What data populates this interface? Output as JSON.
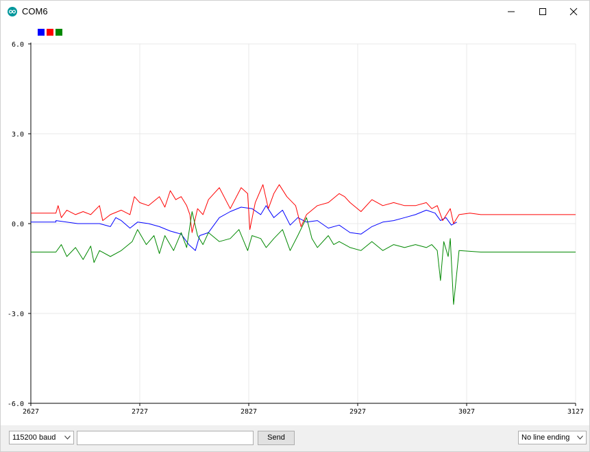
{
  "window": {
    "title": "COM6"
  },
  "legend": {
    "colors": [
      "#0000ff",
      "#ff0000",
      "#008800"
    ]
  },
  "toolbar": {
    "baud": "115200 baud",
    "input_value": "",
    "send_label": "Send",
    "line_ending": "No line ending"
  },
  "chart_data": {
    "type": "line",
    "title": "",
    "xlabel": "",
    "ylabel": "",
    "xlim": [
      2627,
      3127
    ],
    "ylim": [
      -6.0,
      6.0
    ],
    "x_ticks": [
      2627,
      2727,
      2827,
      2927,
      3027,
      3127
    ],
    "y_ticks": [
      6.0,
      3.0,
      0.0,
      -3.0,
      -6.0
    ],
    "y_tick_labels": [
      "6.0",
      "3.0",
      "0.0",
      "-3.0",
      "-6.0"
    ],
    "grid": true,
    "legend_position": "top-left",
    "series": [
      {
        "color": "#0000ff",
        "x": [
          2627,
          2650,
          2650,
          2670,
          2690,
          2700,
          2705,
          2710,
          2718,
          2725,
          2735,
          2745,
          2755,
          2765,
          2772,
          2778,
          2782,
          2790,
          2800,
          2810,
          2820,
          2830,
          2838,
          2843,
          2850,
          2858,
          2865,
          2872,
          2880,
          2890,
          2900,
          2910,
          2920,
          2930,
          2940,
          2950,
          2960,
          2970,
          2980,
          2990,
          2998,
          3003,
          3008,
          3013,
          3018
        ],
        "values": [
          0.05,
          0.05,
          0.1,
          0.0,
          0.0,
          -0.1,
          0.2,
          0.1,
          -0.15,
          0.05,
          0.0,
          -0.1,
          -0.25,
          -0.35,
          -0.7,
          -0.9,
          -0.4,
          -0.3,
          0.2,
          0.4,
          0.55,
          0.5,
          0.3,
          0.6,
          0.2,
          0.45,
          -0.05,
          0.2,
          0.05,
          0.1,
          -0.15,
          -0.05,
          -0.3,
          -0.35,
          -0.1,
          0.05,
          0.1,
          0.2,
          0.3,
          0.45,
          0.35,
          0.1,
          0.2,
          -0.05,
          0.05
        ]
      },
      {
        "color": "#ff0000",
        "x": [
          2627,
          2650,
          2652,
          2655,
          2660,
          2668,
          2675,
          2682,
          2690,
          2693,
          2700,
          2710,
          2718,
          2722,
          2727,
          2735,
          2745,
          2750,
          2755,
          2760,
          2765,
          2770,
          2773,
          2775,
          2780,
          2785,
          2790,
          2795,
          2800,
          2810,
          2820,
          2826,
          2828,
          2833,
          2840,
          2845,
          2850,
          2855,
          2862,
          2870,
          2875,
          2880,
          2890,
          2900,
          2910,
          2915,
          2920,
          2930,
          2940,
          2950,
          2960,
          2970,
          2980,
          2990,
          2995,
          3000,
          3005,
          3012,
          3015,
          3020,
          3030,
          3040,
          3080,
          3127
        ],
        "values": [
          0.35,
          0.35,
          0.6,
          0.2,
          0.45,
          0.3,
          0.4,
          0.3,
          0.6,
          0.1,
          0.3,
          0.45,
          0.3,
          0.9,
          0.7,
          0.6,
          0.9,
          0.55,
          1.1,
          0.8,
          0.9,
          0.6,
          0.3,
          -0.3,
          0.5,
          0.3,
          0.8,
          1.0,
          1.2,
          0.5,
          1.2,
          1.0,
          -0.2,
          0.7,
          1.3,
          0.5,
          1.0,
          1.3,
          0.9,
          0.6,
          -0.1,
          0.3,
          0.6,
          0.7,
          1.0,
          0.9,
          0.7,
          0.4,
          0.8,
          0.6,
          0.7,
          0.6,
          0.6,
          0.7,
          0.5,
          0.6,
          0.1,
          0.5,
          0.0,
          0.3,
          0.35,
          0.3,
          0.3,
          0.3
        ]
      },
      {
        "color": "#008800",
        "x": [
          2627,
          2650,
          2655,
          2660,
          2668,
          2675,
          2682,
          2685,
          2690,
          2700,
          2710,
          2720,
          2725,
          2733,
          2740,
          2745,
          2750,
          2758,
          2765,
          2770,
          2775,
          2780,
          2785,
          2790,
          2800,
          2810,
          2818,
          2826,
          2830,
          2838,
          2843,
          2850,
          2858,
          2865,
          2872,
          2880,
          2885,
          2890,
          2900,
          2905,
          2910,
          2920,
          2930,
          2940,
          2950,
          2960,
          2970,
          2980,
          2990,
          2995,
          3000,
          3003,
          3006,
          3010,
          3012,
          3015,
          3020,
          3040,
          3080,
          3127
        ],
        "values": [
          -0.95,
          -0.95,
          -0.7,
          -1.1,
          -0.8,
          -1.2,
          -0.75,
          -1.3,
          -0.9,
          -1.1,
          -0.9,
          -0.6,
          -0.2,
          -0.7,
          -0.4,
          -1.0,
          -0.4,
          -0.9,
          -0.3,
          -0.8,
          0.4,
          -0.4,
          -0.7,
          -0.3,
          -0.6,
          -0.5,
          -0.2,
          -0.9,
          -0.4,
          -0.5,
          -0.8,
          -0.5,
          -0.2,
          -0.9,
          -0.4,
          0.2,
          -0.5,
          -0.8,
          -0.4,
          -0.7,
          -0.6,
          -0.8,
          -0.9,
          -0.6,
          -0.9,
          -0.7,
          -0.8,
          -0.7,
          -0.8,
          -0.7,
          -0.9,
          -1.9,
          -0.6,
          -1.1,
          -0.5,
          -2.7,
          -0.9,
          -0.95,
          -0.95,
          -0.95
        ]
      }
    ]
  }
}
